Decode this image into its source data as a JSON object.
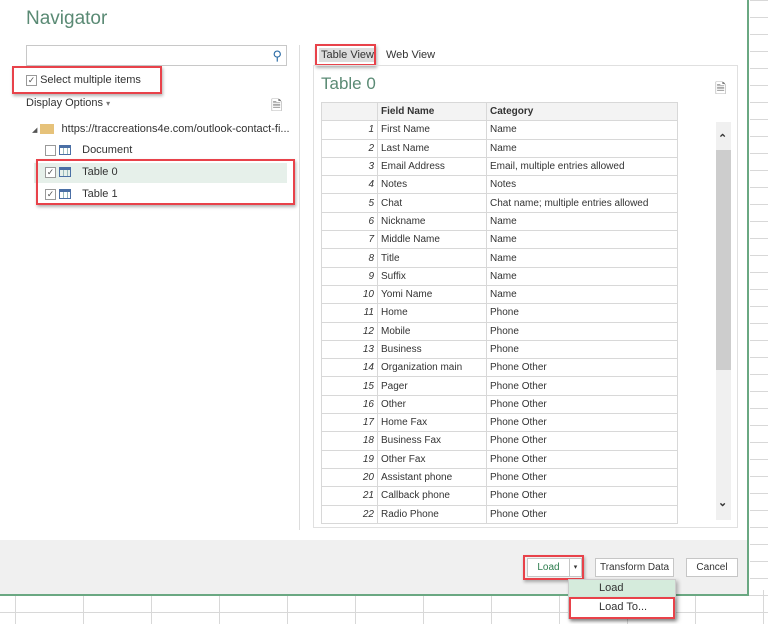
{
  "title": "Navigator",
  "search": {
    "placeholder": ""
  },
  "select_multiple": {
    "label": "Select multiple items",
    "checked": true
  },
  "display_options": "Display Options",
  "tree": {
    "root": "https://traccreations4e.com/outlook-contact-fi...",
    "items": [
      {
        "label": "Document",
        "checked": false
      },
      {
        "label": "Table 0",
        "checked": true,
        "selected": true
      },
      {
        "label": "Table 1",
        "checked": true
      }
    ]
  },
  "tabs": [
    {
      "label": "Table View",
      "active": true
    },
    {
      "label": "Web View"
    }
  ],
  "preview": {
    "title": "Table 0",
    "columns": [
      "",
      "Field Name",
      "Category"
    ],
    "rows": [
      [
        "1",
        "First Name",
        "Name"
      ],
      [
        "2",
        "Last Name",
        "Name"
      ],
      [
        "3",
        "Email Address",
        "Email, multiple entries allowed"
      ],
      [
        "4",
        "Notes",
        "Notes"
      ],
      [
        "5",
        "Chat",
        "Chat name;  multiple entries allowed"
      ],
      [
        "6",
        "Nickname",
        "Name"
      ],
      [
        "7",
        "Middle Name",
        "Name"
      ],
      [
        "8",
        "Title",
        "Name"
      ],
      [
        "9",
        "Suffix",
        "Name"
      ],
      [
        "10",
        "Yomi Name",
        "Name"
      ],
      [
        "11",
        "Home",
        "Phone"
      ],
      [
        "12",
        "Mobile",
        "Phone"
      ],
      [
        "13",
        "Business",
        "Phone"
      ],
      [
        "14",
        "Organization main",
        "Phone Other"
      ],
      [
        "15",
        "Pager",
        "Phone Other"
      ],
      [
        "16",
        "Other",
        "Phone Other"
      ],
      [
        "17",
        "Home Fax",
        "Phone Other"
      ],
      [
        "18",
        "Business Fax",
        "Phone Other"
      ],
      [
        "19",
        "Other Fax",
        "Phone Other"
      ],
      [
        "20",
        "Assistant phone",
        "Phone Other"
      ],
      [
        "21",
        "Callback phone",
        "Phone Other"
      ],
      [
        "22",
        "Radio Phone",
        "Phone Other"
      ]
    ]
  },
  "buttons": {
    "load": "Load",
    "transform": "Transform Data",
    "cancel": "Cancel"
  },
  "load_menu": [
    "Load",
    "Load To..."
  ],
  "colors": {
    "accent": "#5a8a74",
    "highlight": "#e8424a",
    "selected_row": "#e6f0ea"
  }
}
